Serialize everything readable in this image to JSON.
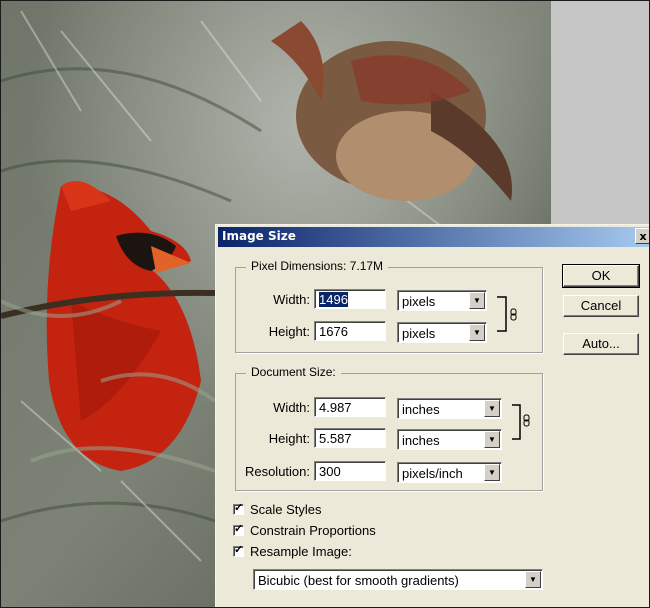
{
  "dialog": {
    "title": "Image Size",
    "close_glyph": "x",
    "pixel_dimensions": {
      "legend": "Pixel Dimensions:  7.17M",
      "width_label": "Width:",
      "width_value": "1496",
      "width_unit": "pixels",
      "height_label": "Height:",
      "height_value": "1676",
      "height_unit": "pixels"
    },
    "document_size": {
      "legend": "Document Size:",
      "width_label": "Width:",
      "width_value": "4.987",
      "width_unit": "inches",
      "height_label": "Height:",
      "height_value": "5.587",
      "height_unit": "inches",
      "resolution_label": "Resolution:",
      "resolution_value": "300",
      "resolution_unit": "pixels/inch"
    },
    "buttons": {
      "ok": "OK",
      "cancel": "Cancel",
      "auto": "Auto..."
    },
    "checkboxes": {
      "scale_styles": {
        "label": "Scale Styles",
        "checked": true
      },
      "constrain": {
        "label": "Constrain Proportions",
        "checked": true
      },
      "resample": {
        "label": "Resample Image:",
        "checked": true
      }
    },
    "resample_method": "Bicubic (best for smooth gradients)",
    "link_icon_name": "chain-link-icon"
  },
  "photo": {
    "subject_icon": "cardinal-birds-photo"
  }
}
